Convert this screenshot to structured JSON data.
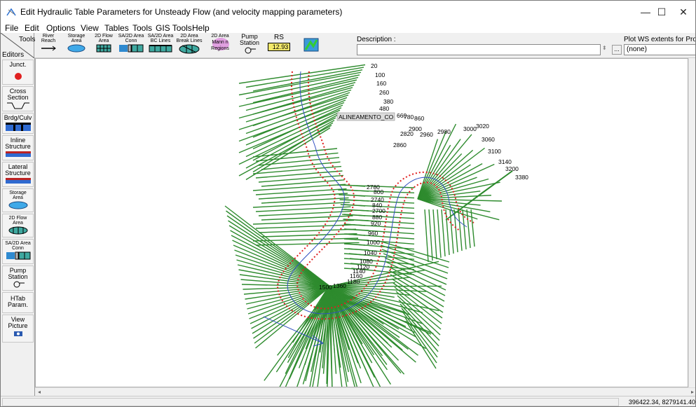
{
  "window": {
    "title": "Edit Hydraulic Table Parameters for Unsteady Flow (and velocity mapping parameters)",
    "minimize": "—",
    "maximize": "☐",
    "close": "✕"
  },
  "menu": [
    "File",
    "Edit",
    "Options",
    "View",
    "Tables",
    "Tools",
    "GIS Tools",
    "Help"
  ],
  "toolbar": {
    "tools_label": "Tools",
    "editors_label": "Editors",
    "buttons": [
      {
        "l1": "River",
        "l2": "Reach"
      },
      {
        "l1": "Storage",
        "l2": "Area"
      },
      {
        "l1": "2D Flow",
        "l2": "Area"
      },
      {
        "l1": "SA/2D Area",
        "l2": "Conn"
      },
      {
        "l1": "SA/2D Area",
        "l2": "BC Lines"
      },
      {
        "l1": "2D Area",
        "l2": "Break Lines"
      },
      {
        "l1": "2D Area",
        "l2": "Mann n",
        "l3": "Regions"
      },
      {
        "l1": "Pump",
        "l2": "Station"
      },
      {
        "l1": "RS",
        "l2": "12.93"
      }
    ],
    "description_label": "Description :",
    "description_value": "",
    "ellipsis": "...",
    "profile_label": "Plot WS extents for Profile",
    "profile_value": "(none)"
  },
  "editors": [
    {
      "l1": "Junct.",
      "icon": "junction-icon"
    },
    {
      "l1": "Cross",
      "l2": "Section",
      "icon": "cross-section-icon"
    },
    {
      "l1": "Brdg/Culv",
      "icon": "bridge-culvert-icon"
    },
    {
      "l1": "Inline",
      "l2": "Structure",
      "icon": "inline-structure-icon"
    },
    {
      "l1": "Lateral",
      "l2": "Structure",
      "icon": "lateral-structure-icon"
    },
    {
      "l1": "Storage",
      "l2": "Area",
      "icon": "storage-area-icon"
    },
    {
      "l1": "2D Flow",
      "l2": "Area",
      "icon": "2d-flow-area-icon"
    },
    {
      "l1": "SA/2D Area",
      "l2": "Conn",
      "icon": "sa-2d-conn-icon"
    },
    {
      "l1": "Pump",
      "l2": "Station",
      "icon": "pump-icon"
    },
    {
      "l1": "HTab",
      "l2": "Param.",
      "icon": ""
    },
    {
      "l1": "View",
      "l2": "Picture",
      "icon": "camera-icon"
    }
  ],
  "map": {
    "reach_label": "ALINEAMENTO_CO",
    "xs_color": "#2e8b2e",
    "bank_color": "#e02020",
    "river_color": "#3050c0",
    "labels_top": [
      "20",
      "100",
      "160",
      "260",
      "380",
      "480",
      "660",
      "780",
      "860",
      "2900",
      "2820",
      "2960",
      "2980",
      "3000",
      "3020",
      "3060",
      "3100",
      "3140",
      "3200",
      "3380",
      "2860"
    ],
    "labels_mid": [
      "2780",
      "800",
      "2740",
      "840",
      "2700",
      "880",
      "920",
      "960",
      "1000",
      "1040",
      "1080",
      "1120",
      "1140",
      "1160",
      "1180",
      "1360",
      "1500"
    ]
  },
  "status": {
    "coords": "396422.34, 8279141.40"
  }
}
